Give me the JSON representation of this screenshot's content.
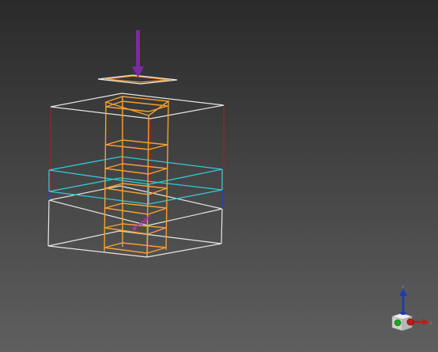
{
  "viewport": {
    "background_top": "#2a2a2a",
    "background_bottom": "#5f5f5f"
  },
  "scene": {
    "load_arrow_color": "#7b2aa0",
    "column_color": "#f5a030",
    "top_plate_color": "#e8e8e8",
    "red_cage_color": "#a42020",
    "cyan_slab_color": "#35c8d6",
    "white_frame_color": "#e6e6e6",
    "blue_edge_color": "#2a3cc8",
    "magenta_marker_color": "#b030b0"
  },
  "gizmo": {
    "z_label": "z",
    "x_label": "x",
    "z_axis_color": "#1a3ab8",
    "x_axis_color": "#c01818",
    "y_dot_color": "#1aa81a",
    "cube_color": "#d9d9d9"
  }
}
